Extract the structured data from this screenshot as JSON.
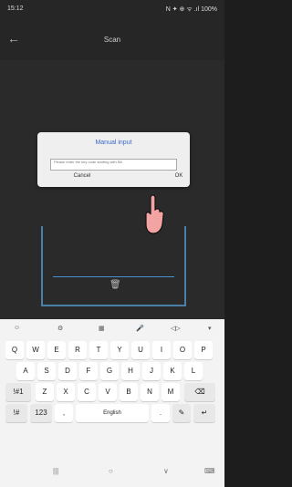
{
  "status": {
    "time": "15:12",
    "right": "N ✦ ⊕ ᯤ .ıl 100%"
  },
  "appbar": {
    "back_icon": "arrow-left-icon",
    "title": "Scan"
  },
  "dialog": {
    "title": "Manual input",
    "placeholder": "Please enter the key code starting with B8",
    "cancel": "Cancel",
    "ok": "OK"
  },
  "scan": {
    "trash_icon": "trash-icon"
  },
  "keyboard": {
    "toolbar": [
      "☺",
      "⚙",
      "▦",
      "🎤",
      "◁▷",
      "▾"
    ],
    "row1": [
      "Q",
      "W",
      "E",
      "R",
      "T",
      "Y",
      "U",
      "I",
      "O",
      "P"
    ],
    "row2": [
      "A",
      "S",
      "D",
      "F",
      "G",
      "H",
      "J",
      "K",
      "L"
    ],
    "row3": [
      "!#1",
      "Z",
      "X",
      "C",
      "V",
      "B",
      "N",
      "M",
      "⌫"
    ],
    "row4": [
      "!#",
      "123",
      ",",
      "English",
      "",
      ".",
      "✎",
      "↵"
    ]
  },
  "nav": {
    "left": "|||",
    "home": "○",
    "back": "∨",
    "keyboard": "⌨"
  }
}
